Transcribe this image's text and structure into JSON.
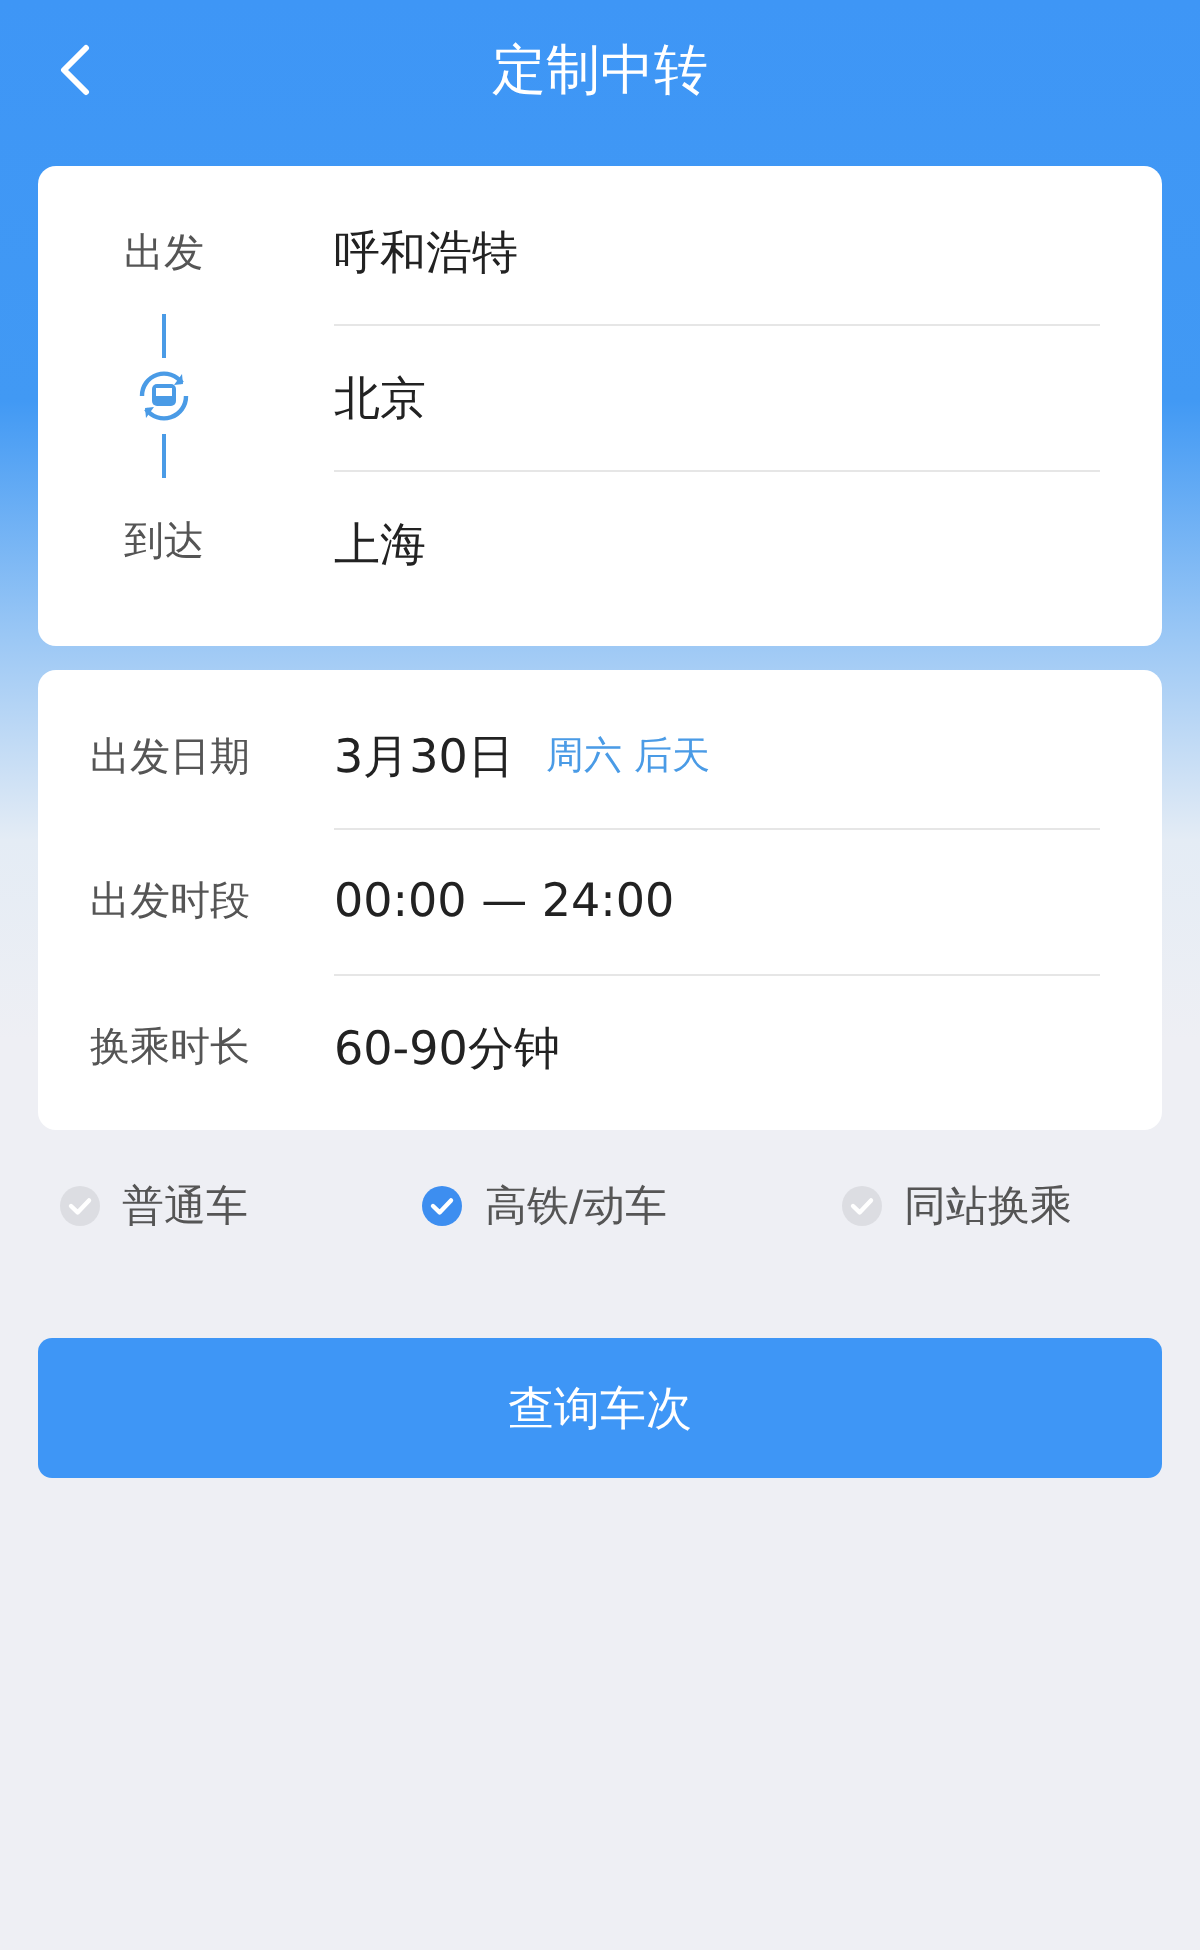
{
  "header": {
    "title": "定制中转"
  },
  "route": {
    "departure_label": "出发",
    "arrival_label": "到达",
    "stations": [
      {
        "name": "呼和浩特"
      },
      {
        "name": "北京"
      },
      {
        "name": "上海"
      }
    ]
  },
  "settings": [
    {
      "label": "出发日期",
      "value": "3月30日",
      "note": "周六 后天"
    },
    {
      "label": "出发时段",
      "value": "00:00 — 24:00"
    },
    {
      "label": "换乘时长",
      "value": "60-90分钟"
    }
  ],
  "options": [
    {
      "label": "普通车",
      "checked": false
    },
    {
      "label": "高铁/动车",
      "checked": true
    },
    {
      "label": "同站换乘",
      "checked": false
    }
  ],
  "search_button": "查询车次"
}
